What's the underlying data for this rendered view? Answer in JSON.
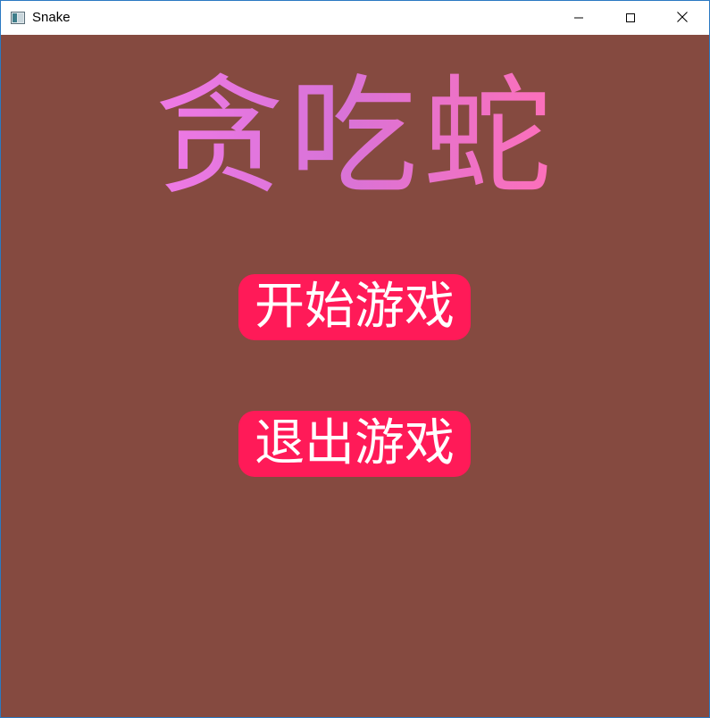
{
  "window": {
    "title": "Snake",
    "icon": "app-window-icon",
    "controls": {
      "minimize": "minimize-icon",
      "maximize": "maximize-icon",
      "close": "close-icon"
    }
  },
  "game": {
    "title": "贪吃蛇",
    "start_label": "开始游戏",
    "quit_label": "退出游戏"
  },
  "colors": {
    "background": "#854a40",
    "button": "#ff1a58",
    "button_text": "#ffffff",
    "title_gradient": [
      "#f07ae6",
      "#d873d8",
      "#ff70b8"
    ],
    "window_border": "#2b79c2"
  }
}
